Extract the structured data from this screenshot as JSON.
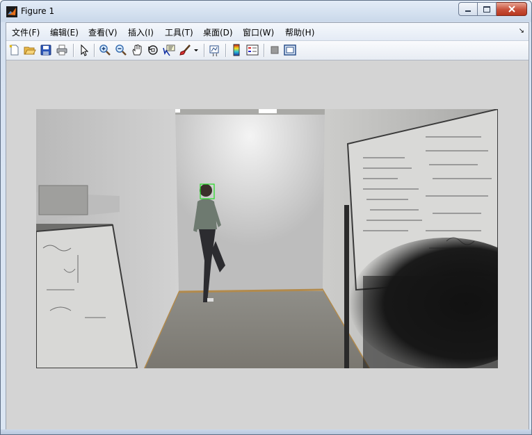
{
  "window": {
    "title": "Figure 1",
    "icon": "matlab-logo-icon",
    "controls": [
      "minimize-icon",
      "maximize-icon",
      "close-icon"
    ]
  },
  "menu": {
    "items": [
      "文件(F)",
      "编辑(E)",
      "查看(V)",
      "插入(I)",
      "工具(T)",
      "桌面(D)",
      "窗口(W)",
      "帮助(H)"
    ],
    "dock_arrow": "↘"
  },
  "toolbar": {
    "buttons": [
      "new-figure-icon",
      "open-file-icon",
      "save-icon",
      "print-icon",
      "edit-plot-icon",
      "zoom-in-icon",
      "zoom-out-icon",
      "pan-icon",
      "rotate-3d-icon",
      "data-cursor-icon",
      "brush-icon",
      "brush-dropdown-icon",
      "link-plot-icon",
      "insert-colorbar-icon",
      "insert-legend-icon",
      "hide-plot-tools-icon",
      "show-plot-tools-icon"
    ]
  },
  "axes": {
    "content": "camera image of corridor with person; green face detection box",
    "detection_box_color": "#22dd22"
  },
  "colors": {
    "figure_background": "#d4d4d4",
    "frame": "#dbe6f3"
  }
}
